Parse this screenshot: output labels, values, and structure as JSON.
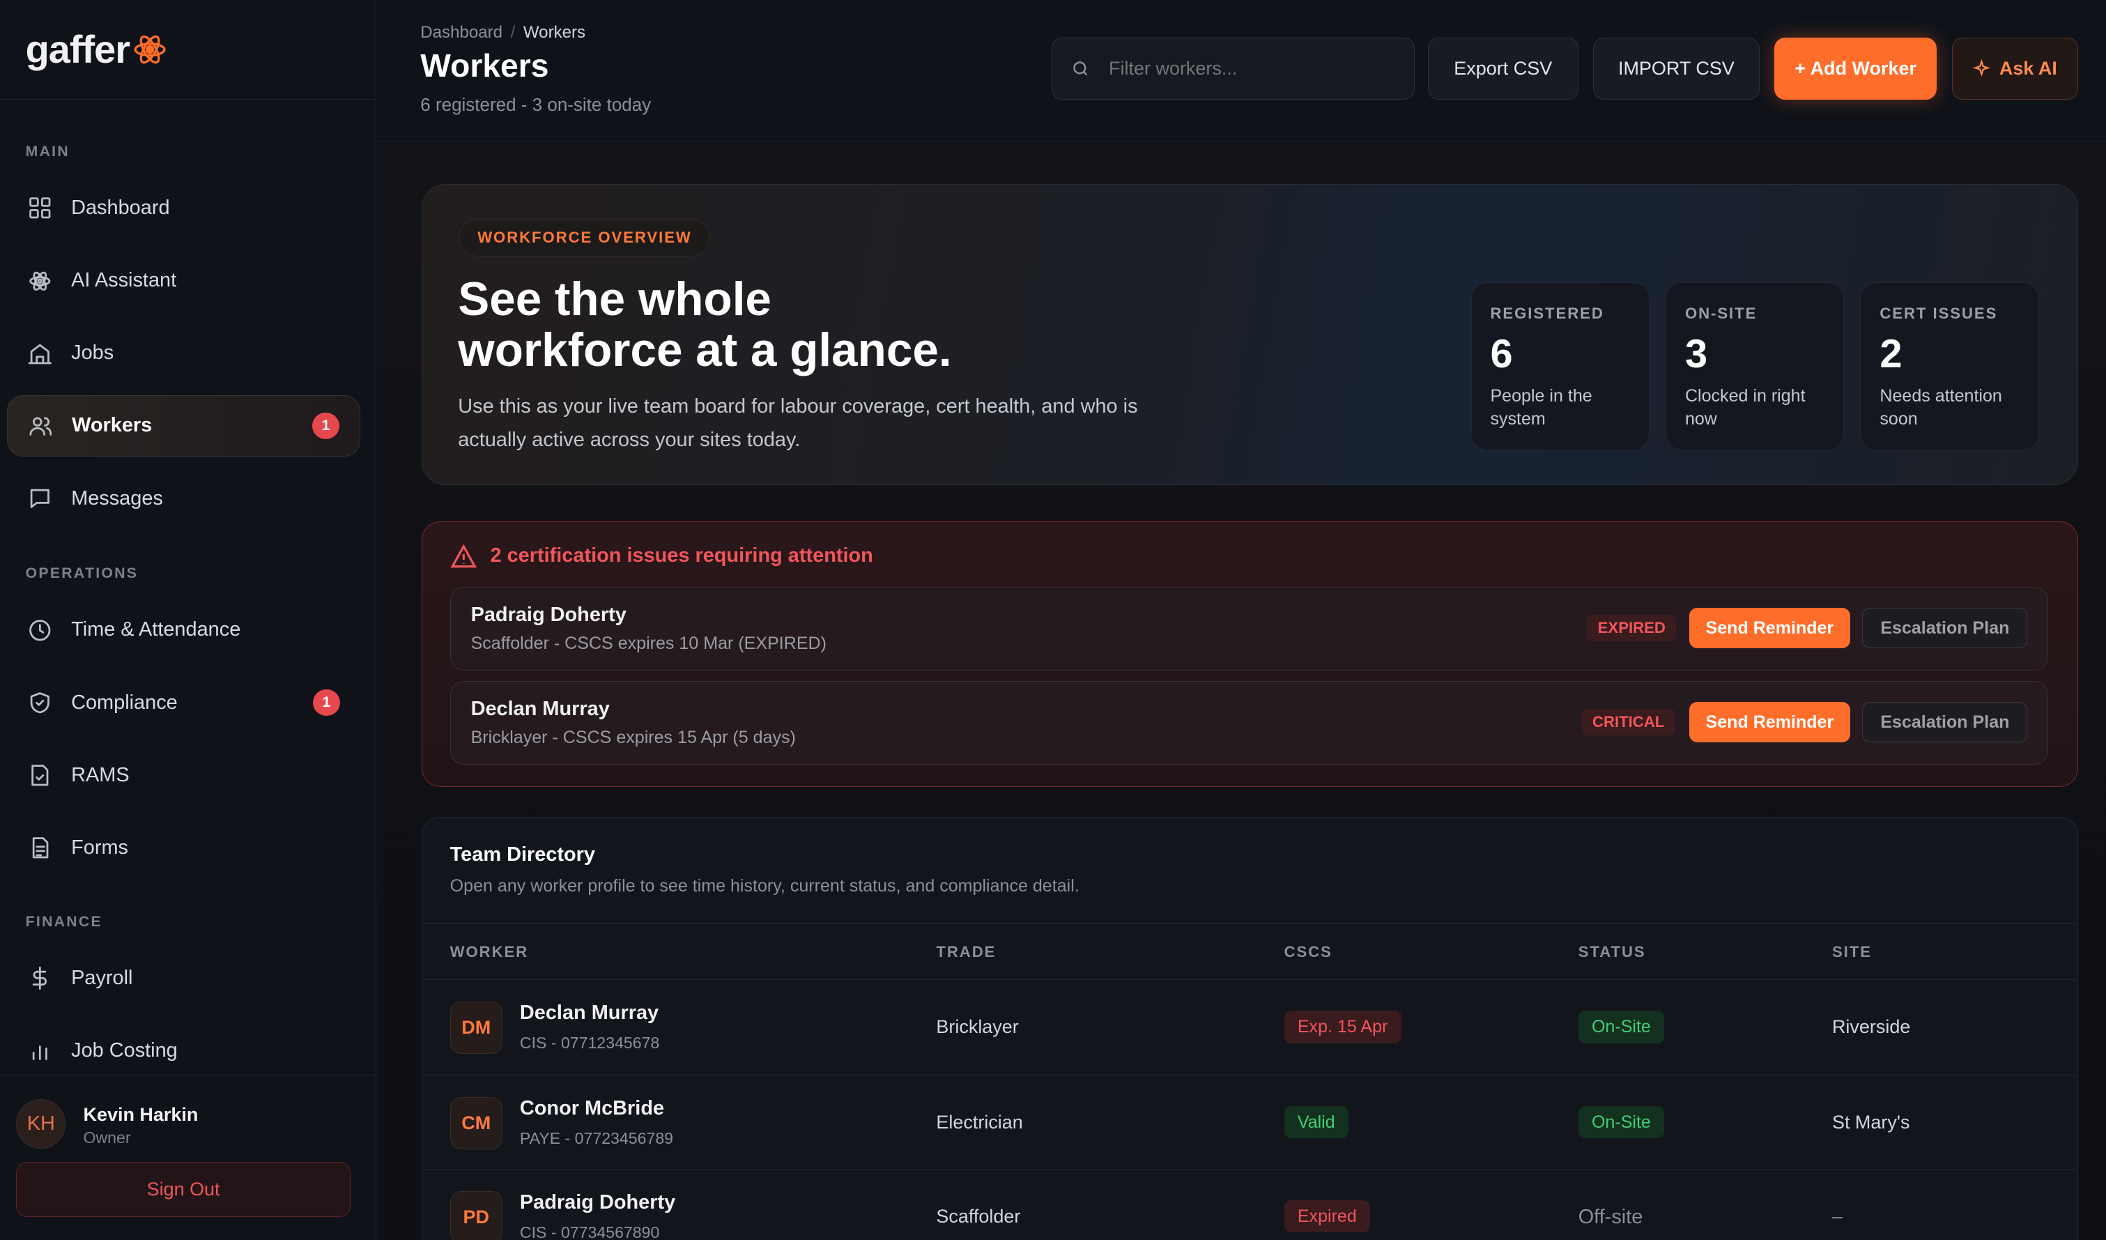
{
  "app": {
    "name": "gaffer"
  },
  "sidebar": {
    "sections": {
      "main": "MAIN",
      "operations": "OPERATIONS",
      "finance": "FINANCE"
    },
    "items": [
      {
        "label": "Dashboard",
        "icon": "grid-icon"
      },
      {
        "label": "AI Assistant",
        "icon": "atom-icon"
      },
      {
        "label": "Jobs",
        "icon": "building-icon"
      },
      {
        "label": "Workers",
        "icon": "users-icon",
        "badge": "1",
        "active": true
      },
      {
        "label": "Messages",
        "icon": "message-icon"
      },
      {
        "label": "Time & Attendance",
        "icon": "clock-icon"
      },
      {
        "label": "Compliance",
        "icon": "shield-icon",
        "badge": "1"
      },
      {
        "label": "RAMS",
        "icon": "document-check-icon"
      },
      {
        "label": "Forms",
        "icon": "form-icon"
      },
      {
        "label": "Payroll",
        "icon": "dollar-icon"
      },
      {
        "label": "Job Costing",
        "icon": "bar-chart-icon"
      }
    ],
    "user": {
      "initials": "KH",
      "name": "Kevin Harkin",
      "role": "Owner"
    },
    "sign_out": "Sign Out"
  },
  "header": {
    "breadcrumb": {
      "root": "Dashboard",
      "sep": "/",
      "current": "Workers"
    },
    "title": "Workers",
    "subtitle": "6 registered - 3 on-site today",
    "search_placeholder": "Filter workers...",
    "export_label": "Export CSV",
    "import_label": "IMPORT CSV",
    "add_label": "+ Add Worker",
    "ask_label": "Ask AI"
  },
  "hero": {
    "pill": "WORKFORCE OVERVIEW",
    "title_line1": "See the whole",
    "title_line2": "workforce at a glance.",
    "desc_line1": "Use this as your live team board for labour coverage, cert health, and who is",
    "desc_line2": "actually active across your sites today.",
    "stats": [
      {
        "label": "REGISTERED",
        "value": "6",
        "sub": "People in the system"
      },
      {
        "label": "ON-SITE",
        "value": "3",
        "sub": "Clocked in right now"
      },
      {
        "label": "CERT ISSUES",
        "value": "2",
        "sub": "Needs attention soon"
      }
    ]
  },
  "alerts": {
    "title": "2 certification issues requiring attention",
    "send_label": "Send Reminder",
    "escalate_label": "Escalation Plan",
    "rows": [
      {
        "name": "Padraig Doherty",
        "desc": "Scaffolder - CSCS expires 10 Mar (EXPIRED)",
        "tag": "EXPIRED"
      },
      {
        "name": "Declan Murray",
        "desc": "Bricklayer - CSCS expires 15 Apr (5 days)",
        "tag": "CRITICAL"
      }
    ]
  },
  "directory": {
    "title": "Team Directory",
    "subtitle": "Open any worker profile to see time history, current status, and compliance detail.",
    "columns": [
      "WORKER",
      "TRADE",
      "CSCS",
      "STATUS",
      "SITE"
    ],
    "rows": [
      {
        "initials": "DM",
        "name": "Declan Murray",
        "sub": "CIS - 07712345678",
        "trade": "Bricklayer",
        "cscs": "Exp. 15 Apr",
        "status": "On-Site",
        "site": "Riverside"
      },
      {
        "initials": "CM",
        "name": "Conor McBride",
        "sub": "PAYE - 07723456789",
        "trade": "Electrician",
        "cscs": "Valid",
        "status": "On-Site",
        "site": "St Mary's"
      },
      {
        "initials": "PD",
        "name": "Padraig Doherty",
        "sub": "CIS - 07734567890",
        "trade": "Scaffolder",
        "cscs": "Expired",
        "status": "Off-site",
        "site": "–"
      }
    ]
  },
  "colors": {
    "accent": "#ff6d2a",
    "danger": "#f0565b",
    "success": "#3fcf7a",
    "background": "#0d1017"
  }
}
